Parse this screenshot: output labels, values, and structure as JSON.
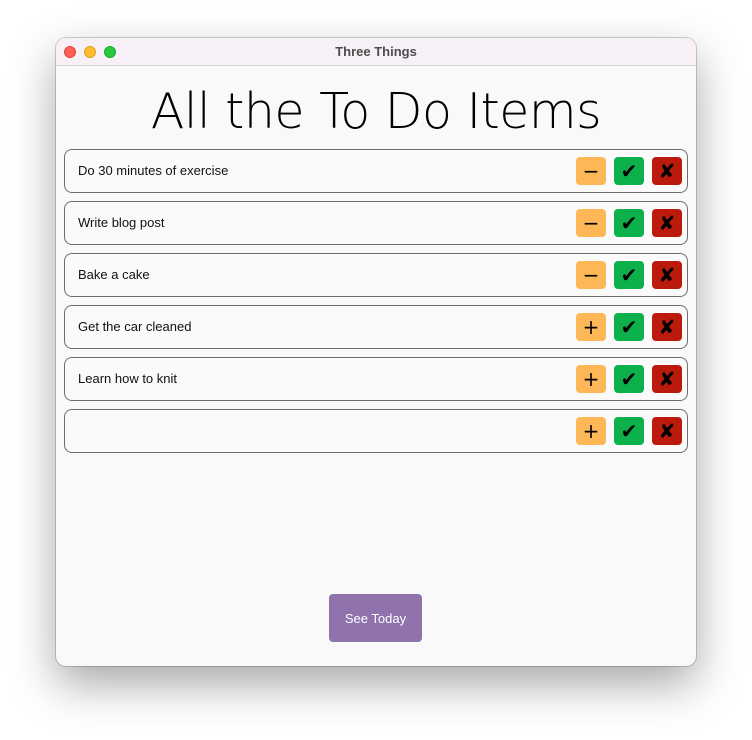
{
  "window": {
    "title": "Three Things"
  },
  "heading": "All the To Do Items",
  "items": [
    {
      "text": "Do 30 minutes of exercise",
      "defer_icon": "−",
      "defer_icon_name": "minus-icon"
    },
    {
      "text": "Write blog post",
      "defer_icon": "−",
      "defer_icon_name": "minus-icon"
    },
    {
      "text": "Bake a cake",
      "defer_icon": "−",
      "defer_icon_name": "minus-icon"
    },
    {
      "text": "Get the car cleaned",
      "defer_icon": "+",
      "defer_icon_name": "plus-icon"
    },
    {
      "text": "Learn how to knit",
      "defer_icon": "+",
      "defer_icon_name": "plus-icon"
    },
    {
      "text": "",
      "defer_icon": "+",
      "defer_icon_name": "plus-icon"
    }
  ],
  "icons": {
    "done": "✔",
    "done_name": "checkmark-icon",
    "delete": "✘",
    "delete_name": "cross-icon"
  },
  "footer": {
    "see_today_label": "See Today"
  },
  "colors": {
    "defer": "#fdb756",
    "done": "#0db14b",
    "delete": "#bd1a0e",
    "primary_button": "#9072ad"
  }
}
